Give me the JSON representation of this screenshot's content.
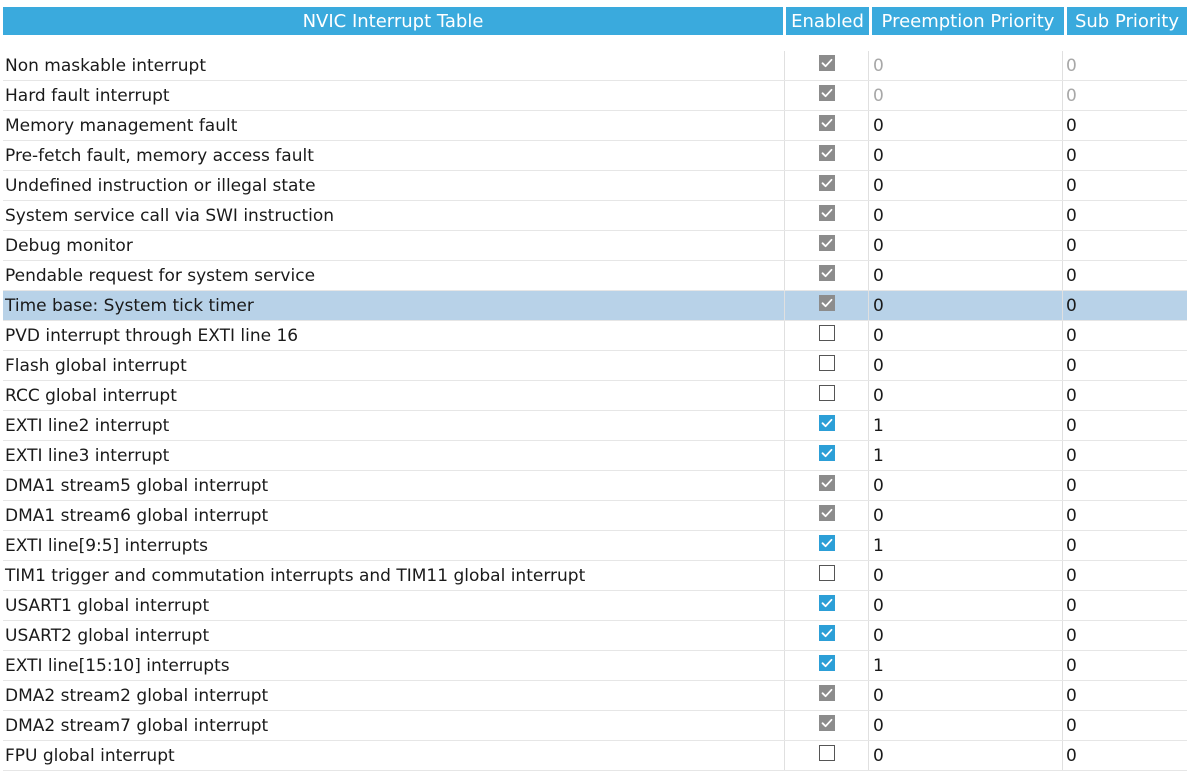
{
  "header": {
    "title": "NVIC Interrupt Table",
    "enabled": "Enabled",
    "preemption": "Preemption Priority",
    "sub": "Sub Priority"
  },
  "colors": {
    "header_bg": "#3aaadd",
    "selected_row": "#b8d2e8",
    "checkbox_checked": "#2c9fd7",
    "checkbox_locked": "#8c8c8c"
  },
  "rows": [
    {
      "name": "Non maskable interrupt",
      "enabled": "locked",
      "preemption": "0",
      "sub": "0",
      "greyed": true
    },
    {
      "name": "Hard fault interrupt",
      "enabled": "locked",
      "preemption": "0",
      "sub": "0",
      "greyed": true
    },
    {
      "name": "Memory management fault",
      "enabled": "locked",
      "preemption": "0",
      "sub": "0"
    },
    {
      "name": "Pre-fetch fault, memory access fault",
      "enabled": "locked",
      "preemption": "0",
      "sub": "0"
    },
    {
      "name": "Undefined instruction or illegal state",
      "enabled": "locked",
      "preemption": "0",
      "sub": "0"
    },
    {
      "name": "System service call via SWI instruction",
      "enabled": "locked",
      "preemption": "0",
      "sub": "0"
    },
    {
      "name": "Debug monitor",
      "enabled": "locked",
      "preemption": "0",
      "sub": "0"
    },
    {
      "name": "Pendable request for system service",
      "enabled": "locked",
      "preemption": "0",
      "sub": "0"
    },
    {
      "name": "Time base: System tick timer",
      "enabled": "locked",
      "preemption": "0",
      "sub": "0",
      "selected": true
    },
    {
      "name": "PVD interrupt through EXTI line 16",
      "enabled": "unchecked",
      "preemption": "0",
      "sub": "0"
    },
    {
      "name": "Flash global interrupt",
      "enabled": "unchecked",
      "preemption": "0",
      "sub": "0"
    },
    {
      "name": "RCC global interrupt",
      "enabled": "unchecked",
      "preemption": "0",
      "sub": "0"
    },
    {
      "name": "EXTI line2 interrupt",
      "enabled": "checked",
      "preemption": "1",
      "sub": "0"
    },
    {
      "name": "EXTI line3 interrupt",
      "enabled": "checked",
      "preemption": "1",
      "sub": "0"
    },
    {
      "name": "DMA1 stream5 global interrupt",
      "enabled": "locked",
      "preemption": "0",
      "sub": "0"
    },
    {
      "name": "DMA1 stream6 global interrupt",
      "enabled": "locked",
      "preemption": "0",
      "sub": "0"
    },
    {
      "name": "EXTI line[9:5] interrupts",
      "enabled": "checked",
      "preemption": "1",
      "sub": "0"
    },
    {
      "name": "TIM1 trigger and commutation interrupts and TIM11 global interrupt",
      "enabled": "unchecked",
      "preemption": "0",
      "sub": "0"
    },
    {
      "name": "USART1 global interrupt",
      "enabled": "checked",
      "preemption": "0",
      "sub": "0"
    },
    {
      "name": "USART2 global interrupt",
      "enabled": "checked",
      "preemption": "0",
      "sub": "0"
    },
    {
      "name": "EXTI line[15:10] interrupts",
      "enabled": "checked",
      "preemption": "1",
      "sub": "0"
    },
    {
      "name": "DMA2 stream2 global interrupt",
      "enabled": "locked",
      "preemption": "0",
      "sub": "0"
    },
    {
      "name": "DMA2 stream7 global interrupt",
      "enabled": "locked",
      "preemption": "0",
      "sub": "0"
    },
    {
      "name": "FPU global interrupt",
      "enabled": "unchecked",
      "preemption": "0",
      "sub": "0"
    }
  ]
}
